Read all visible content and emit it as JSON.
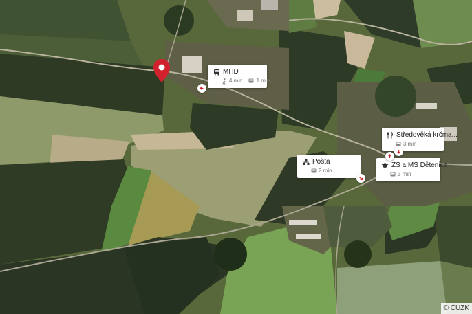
{
  "map": {
    "attribution": "© ČÚZK"
  },
  "pois": {
    "mhd": {
      "name": "MHD",
      "walk_time": "4 min",
      "bus_time": "1 min"
    },
    "posta": {
      "name": "Pošta",
      "bus_time": "2 min"
    },
    "krcma": {
      "name": "Středověká krčma...",
      "bus_time": "3 min"
    },
    "skola": {
      "name": "ZŠ a MŠ Dětenice",
      "bus_time": "3 min"
    }
  },
  "icons": {
    "marker": "location-pin-icon",
    "mhd": "bus-icon",
    "posta": "post-icon",
    "krcma": "restaurant-icon",
    "skola": "school-icon",
    "walk": "walk-icon",
    "transit": "bus-icon"
  },
  "colors": {
    "marker": "#d0212d",
    "label_bg": "#ffffff",
    "label_text": "#222222",
    "label_subtext": "#777777"
  }
}
